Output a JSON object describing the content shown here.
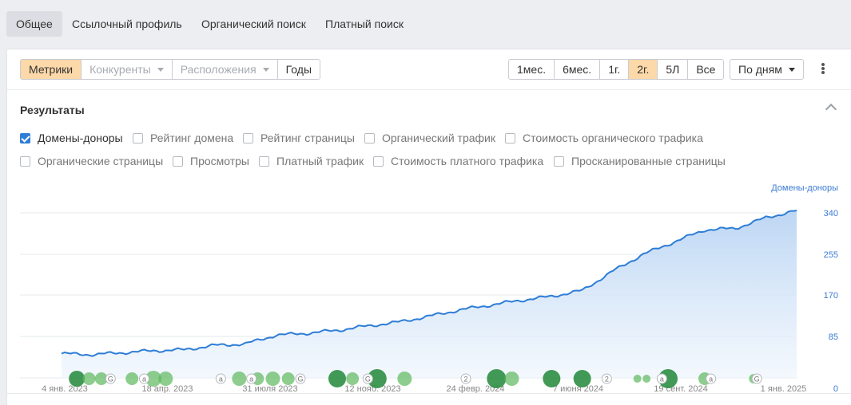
{
  "nav": {
    "tabs": [
      {
        "label": "Общее",
        "active": true
      },
      {
        "label": "Ссылочный профиль",
        "active": false
      },
      {
        "label": "Органический поиск",
        "active": false
      },
      {
        "label": "Платный поиск",
        "active": false
      }
    ]
  },
  "toolbar": {
    "view_tabs": [
      "Метрики",
      "Конкуренты",
      "Расположения",
      "Годы"
    ],
    "active_view": "Метрики",
    "ranges": [
      "1мес.",
      "6мес.",
      "1г.",
      "2г.",
      "5Л",
      "Все"
    ],
    "active_range": "2г.",
    "granularity": "По дням"
  },
  "section": {
    "title": "Результаты",
    "checkboxes_row1": [
      {
        "label": "Домены-доноры",
        "checked": true
      },
      {
        "label": "Рейтинг домена",
        "checked": false
      },
      {
        "label": "Рейтинг страницы",
        "checked": false
      },
      {
        "label": "Органический трафик",
        "checked": false
      },
      {
        "label": "Стоимость органического трафика",
        "checked": false
      }
    ],
    "checkboxes_row2": [
      {
        "label": "Органические страницы",
        "checked": false
      },
      {
        "label": "Просмотры",
        "checked": false
      },
      {
        "label": "Платный трафик",
        "checked": false
      },
      {
        "label": "Стоимость платного трафика",
        "checked": false
      },
      {
        "label": "Просканированные страницы",
        "checked": false
      }
    ]
  },
  "colors": {
    "line": "#2e7dd6",
    "accent": "#fdd8a8",
    "marker_green": "#2e9e45",
    "axis_text": "#3a7bd5"
  },
  "chart_data": {
    "type": "area",
    "series": [
      {
        "name": "Домены-доноры"
      }
    ],
    "y_ticks": [
      "340",
      "255",
      "170",
      "85",
      "0"
    ],
    "ylim": [
      0,
      425
    ],
    "x_ticks": [
      "4 янв. 2023",
      "18 апр. 2023",
      "31 июля 2023",
      "12 нояб. 2023",
      "24 февр. 2024",
      "7 июня 2024",
      "19 сент. 2024",
      "1 янв. 2025"
    ],
    "x_index": [
      0,
      1,
      2,
      3,
      4,
      5,
      6,
      7,
      8,
      9,
      10,
      11,
      12,
      13,
      14,
      15,
      16,
      17,
      18,
      19,
      20,
      21,
      22,
      23,
      24
    ],
    "values": [
      50,
      48,
      52,
      56,
      58,
      67,
      70,
      88,
      92,
      98,
      107,
      115,
      127,
      140,
      150,
      160,
      168,
      180,
      220,
      255,
      280,
      305,
      308,
      330,
      345
    ],
    "grid": true,
    "legend": "none",
    "events": [
      {
        "x": 0.5,
        "r": 10,
        "dark": true
      },
      {
        "x": 0.9,
        "r": 8,
        "dark": false
      },
      {
        "x": 1.3,
        "r": 8,
        "dark": false
      },
      {
        "x": 2.3,
        "r": 8,
        "dark": false
      },
      {
        "x": 3.0,
        "r": 10,
        "dark": false
      },
      {
        "x": 3.4,
        "r": 9,
        "dark": false
      },
      {
        "x": 5.8,
        "r": 9,
        "dark": false
      },
      {
        "x": 6.4,
        "r": 8,
        "dark": false
      },
      {
        "x": 6.9,
        "r": 9,
        "dark": false
      },
      {
        "x": 7.4,
        "r": 8,
        "dark": false
      },
      {
        "x": 9.0,
        "r": 11,
        "dark": true
      },
      {
        "x": 9.5,
        "r": 8,
        "dark": false
      },
      {
        "x": 10.3,
        "r": 12,
        "dark": true
      },
      {
        "x": 11.2,
        "r": 9,
        "dark": false
      },
      {
        "x": 14.2,
        "r": 12,
        "dark": true
      },
      {
        "x": 14.7,
        "r": 9,
        "dark": false
      },
      {
        "x": 16.0,
        "r": 11,
        "dark": true
      },
      {
        "x": 17.0,
        "r": 11,
        "dark": true
      },
      {
        "x": 18.8,
        "r": 5,
        "dark": false
      },
      {
        "x": 19.1,
        "r": 5,
        "dark": false
      },
      {
        "x": 19.8,
        "r": 12,
        "dark": true
      },
      {
        "x": 21.0,
        "r": 8,
        "dark": false
      },
      {
        "x": 22.6,
        "r": 6,
        "dark": false
      }
    ],
    "annotation_icons": [
      {
        "x": 1.6,
        "char": "G"
      },
      {
        "x": 2.7,
        "char": "a"
      },
      {
        "x": 5.2,
        "char": "a"
      },
      {
        "x": 6.2,
        "char": "a"
      },
      {
        "x": 7.8,
        "char": "G"
      },
      {
        "x": 10.0,
        "char": "G"
      },
      {
        "x": 13.2,
        "char": "2"
      },
      {
        "x": 17.8,
        "char": "2"
      },
      {
        "x": 19.6,
        "char": "a"
      },
      {
        "x": 21.2,
        "char": "a"
      },
      {
        "x": 22.7,
        "char": "G"
      }
    ]
  }
}
